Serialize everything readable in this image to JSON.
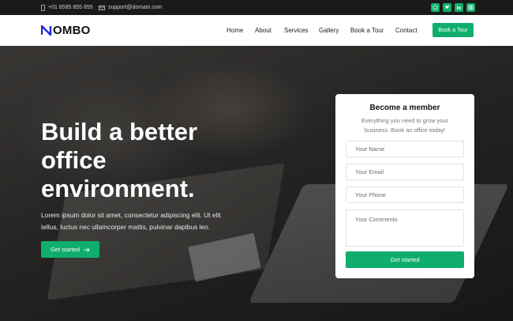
{
  "topbar": {
    "phone": "+01 8585 855 855",
    "email": "support@domain.com",
    "socials": [
      "whatsapp-icon",
      "twitter-icon",
      "linkedin-icon",
      "instagram-icon"
    ]
  },
  "brand": {
    "logo_text": "OMBO",
    "accent_color": "#0fae6c",
    "logo_mark_color": "#1a2bd6"
  },
  "nav": {
    "items": [
      "Home",
      "About",
      "Services",
      "Gallery",
      "Book a Tour",
      "Contact"
    ],
    "cta_label": "Book a Tour"
  },
  "hero": {
    "headline": [
      "Build a better",
      "office",
      "environment."
    ],
    "description": [
      "Lorem ipsum dolor sit amet, consectetur adipiscing elit. Ut elit",
      "tellus, luctus nec ullamcorper mattis, pulvinar dapibus leo."
    ],
    "button_label": "Get started"
  },
  "form": {
    "title": "Become a member",
    "subtitle": [
      "Everything you need to grow your",
      "business. Book an office today!"
    ],
    "name_placeholder": "Your Name",
    "email_placeholder": "Your Email",
    "phone_placeholder": "Your Phone",
    "comments_placeholder": "Your Comments",
    "submit_label": "Get started"
  }
}
